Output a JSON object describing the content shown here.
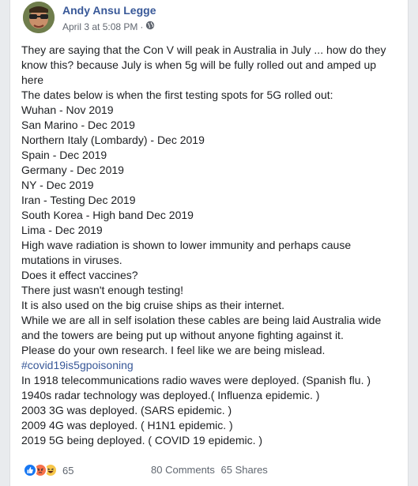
{
  "post": {
    "author": "Andy Ansu Legge",
    "timestamp": "April 3 at 5:08 PM",
    "separator": "·",
    "privacy_icon": "globe-icon",
    "text_lines": [
      "They are saying that the Con V will peak in Australia in July ... how do they know this? because July is when 5g will be fully rolled out and amped up here",
      "The dates below is when the first testing spots for 5G rolled out:",
      "Wuhan - Nov 2019",
      "San Marino - Dec 2019",
      "Northern Italy (Lombardy) - Dec 2019",
      "Spain - Dec 2019",
      "Germany - Dec 2019",
      "NY - Dec 2019",
      "Iran - Testing Dec 2019",
      "South Korea - High band Dec 2019",
      "Lima - Dec 2019",
      "High wave radiation is shown to lower immunity and perhaps cause mutations in viruses.",
      "Does it effect vaccines?",
      "There just wasn't enough testing!",
      "It is also used on the big cruise ships as their internet.",
      "While we are all in self isolation these cables are being laid Australia wide and the towers are being put up without anyone fighting against it.",
      "Please do your own research. I feel like we are being mislead."
    ],
    "hashtag": "#covid19is5gpoisoning",
    "history_lines": [
      "In 1918 telecommunications radio waves were deployed. (Spanish flu. )",
      "1940s radar technology was deployed.( Influenza epidemic. )",
      "2003 3G was deployed. (SARS epidemic. )",
      "2009 4G was deployed. ( H1N1 epidemic. )",
      "2019 5G being deployed. ( COVID 19 epidemic. )"
    ]
  },
  "footer": {
    "reaction_icons": [
      "like-icon",
      "angry-icon",
      "haha-icon"
    ],
    "reaction_count": "65",
    "comments": "80 Comments",
    "shares": "65 Shares"
  },
  "colors": {
    "link": "#385898",
    "text": "#1c1e21",
    "meta": "#616770",
    "like": "#1877f2",
    "angry": "#f7714b",
    "haha": "#f7c64a"
  }
}
